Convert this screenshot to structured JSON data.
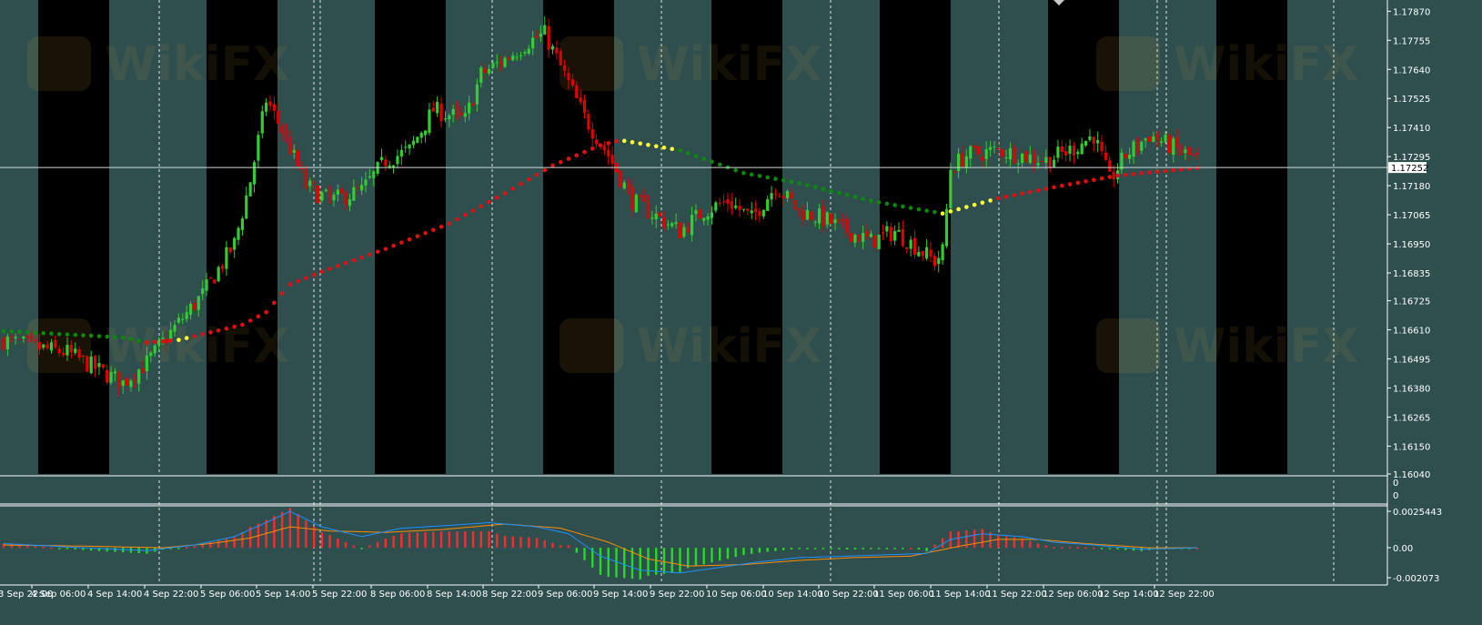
{
  "colors": {
    "background": "#2f4f4f",
    "session_band": "#000000",
    "bull_candle": "#32cd32",
    "bear_candle": "#e10000",
    "ma_up": "#e01010",
    "ma_flat": "#ffff33",
    "ma_down": "#0a8a0a",
    "macd_line": "#1e90ff",
    "signal_line": "#ff8c00",
    "hist_pos": "#ff2a2a",
    "hist_neg": "#22dd22",
    "grid_vline": "#ffffff",
    "axis_text": "#ffffff",
    "price_line": "#cfd8d8",
    "price_tag_bg": "#ffffff",
    "price_tag_fg": "#000000"
  },
  "watermark": {
    "text": "WikiFX"
  },
  "price_axis": {
    "labels": [
      "1.17870",
      "1.17755",
      "1.17640",
      "1.17525",
      "1.17410",
      "1.17295",
      "1.17180",
      "1.17065",
      "1.16950",
      "1.16835",
      "1.16725",
      "1.16610",
      "1.16495",
      "1.16380",
      "1.16265",
      "1.16150",
      "1.16040"
    ],
    "current_price": "1.17252"
  },
  "sub_window_1": {
    "labels": [
      "0",
      "0"
    ]
  },
  "sub_window_2": {
    "labels": [
      "0.0025443",
      "0.00",
      "-0.002073"
    ]
  },
  "time_axis": {
    "labels": [
      "3 Sep 22:00",
      "4 Sep 06:00",
      "4 Sep 14:00",
      "4 Sep 22:00",
      "5 Sep 06:00",
      "5 Sep 14:00",
      "5 Sep 22:00",
      "8 Sep 06:00",
      "8 Sep 14:00",
      "8 Sep 22:00",
      "9 Sep 06:00",
      "9 Sep 14:00",
      "9 Sep 22:00",
      "10 Sep 06:00",
      "10 Sep 14:00",
      "10 Sep 22:00",
      "11 Sep 06:00",
      "11 Sep 14:00",
      "11 Sep 22:00",
      "12 Sep 06:00",
      "12 Sep 14:00",
      "12 Sep 22:00"
    ]
  },
  "chart_data": [
    {
      "type": "candlestick",
      "title": "",
      "y_axis_ticks": [
        1.1787,
        1.17755,
        1.1764,
        1.17525,
        1.1741,
        1.17295,
        1.1718,
        1.17065,
        1.1695,
        1.16835,
        1.16725,
        1.1661,
        1.16495,
        1.1638,
        1.16265,
        1.1615,
        1.1604
      ],
      "ylim": [
        1.1604,
        1.179
      ],
      "x_labels": [
        "3 Sep 22:00",
        "4 Sep 06:00",
        "4 Sep 14:00",
        "4 Sep 22:00",
        "5 Sep 06:00",
        "5 Sep 14:00",
        "5 Sep 22:00",
        "8 Sep 06:00",
        "8 Sep 14:00",
        "8 Sep 22:00",
        "9 Sep 06:00",
        "9 Sep 14:00",
        "9 Sep 22:00",
        "10 Sep 06:00",
        "10 Sep 14:00",
        "10 Sep 22:00",
        "11 Sep 06:00",
        "11 Sep 14:00",
        "11 Sep 22:00",
        "12 Sep 06:00",
        "12 Sep 14:00",
        "12 Sep 22:00"
      ],
      "current_price": 1.17252,
      "close_path": [
        [
          0,
          1.1657
        ],
        [
          8,
          1.1654
        ],
        [
          16,
          1.1652
        ],
        [
          24,
          1.1645
        ],
        [
          30,
          1.164
        ],
        [
          36,
          1.1648
        ],
        [
          42,
          1.166
        ],
        [
          50,
          1.1675
        ],
        [
          58,
          1.1695
        ],
        [
          62,
          1.172
        ],
        [
          66,
          1.1752
        ],
        [
          70,
          1.174
        ],
        [
          76,
          1.1718
        ],
        [
          82,
          1.1712
        ],
        [
          90,
          1.1716
        ],
        [
          96,
          1.1728
        ],
        [
          102,
          1.1732
        ],
        [
          108,
          1.1748
        ],
        [
          116,
          1.1744
        ],
        [
          120,
          1.1762
        ],
        [
          126,
          1.1768
        ],
        [
          132,
          1.1775
        ],
        [
          136,
          1.1778
        ],
        [
          140,
          1.1765
        ],
        [
          146,
          1.1745
        ],
        [
          152,
          1.173
        ],
        [
          158,
          1.1712
        ],
        [
          164,
          1.1706
        ],
        [
          170,
          1.17
        ],
        [
          176,
          1.1708
        ],
        [
          182,
          1.1712
        ],
        [
          188,
          1.1705
        ],
        [
          194,
          1.1718
        ],
        [
          200,
          1.1708
        ],
        [
          206,
          1.1705
        ],
        [
          212,
          1.17
        ],
        [
          218,
          1.1696
        ],
        [
          224,
          1.17
        ],
        [
          230,
          1.1693
        ],
        [
          234,
          1.1688
        ],
        [
          236,
          1.1692
        ],
        [
          238,
          1.1725
        ],
        [
          242,
          1.173
        ],
        [
          250,
          1.1732
        ],
        [
          256,
          1.173
        ],
        [
          262,
          1.1728
        ],
        [
          268,
          1.1732
        ],
        [
          274,
          1.1738
        ],
        [
          278,
          1.172
        ],
        [
          282,
          1.173
        ],
        [
          288,
          1.1738
        ],
        [
          294,
          1.1733
        ],
        [
          300,
          1.1728
        ]
      ],
      "series": [
        {
          "name": "",
          "type": "candles",
          "count": 301,
          "seed": 7
        }
      ],
      "ma_dots": [
        {
          "x": 0,
          "y": 1.16605,
          "state": "down"
        },
        {
          "x": 30,
          "y": 1.1658,
          "state": "down"
        },
        {
          "x": 36,
          "y": 1.1656,
          "state": "up"
        },
        {
          "x": 44,
          "y": 1.1657,
          "state": "flat"
        },
        {
          "x": 48,
          "y": 1.16585,
          "state": "up"
        },
        {
          "x": 60,
          "y": 1.1663,
          "state": "up"
        },
        {
          "x": 66,
          "y": 1.1668,
          "state": "up"
        },
        {
          "x": 72,
          "y": 1.1679,
          "state": "up"
        },
        {
          "x": 80,
          "y": 1.1684,
          "state": "up"
        },
        {
          "x": 96,
          "y": 1.1693,
          "state": "up"
        },
        {
          "x": 112,
          "y": 1.1703,
          "state": "up"
        },
        {
          "x": 126,
          "y": 1.1715,
          "state": "up"
        },
        {
          "x": 138,
          "y": 1.1726,
          "state": "up"
        },
        {
          "x": 150,
          "y": 1.1734,
          "state": "up"
        },
        {
          "x": 155,
          "y": 1.1736,
          "state": "flat"
        },
        {
          "x": 170,
          "y": 1.1732,
          "state": "down"
        },
        {
          "x": 186,
          "y": 1.1723,
          "state": "down"
        },
        {
          "x": 200,
          "y": 1.1719,
          "state": "down"
        },
        {
          "x": 218,
          "y": 1.1712,
          "state": "down"
        },
        {
          "x": 236,
          "y": 1.1707,
          "state": "flat"
        },
        {
          "x": 250,
          "y": 1.1713,
          "state": "up"
        },
        {
          "x": 266,
          "y": 1.1718,
          "state": "up"
        },
        {
          "x": 280,
          "y": 1.1722,
          "state": "up"
        },
        {
          "x": 300,
          "y": 1.1725,
          "state": "up"
        }
      ]
    },
    {
      "type": "line",
      "title": "",
      "y_axis_ticks": [
        0.0025443,
        0.0,
        -0.002073
      ],
      "series": [
        {
          "name": "",
          "kind": "macd",
          "color_key": "macd_line"
        },
        {
          "name": "",
          "kind": "signal",
          "color_key": "signal_line"
        },
        {
          "name": "",
          "kind": "histogram"
        }
      ],
      "macd_path": [
        [
          0,
          0.0003
        ],
        [
          20,
          0.0
        ],
        [
          36,
          -0.0002
        ],
        [
          48,
          0.0002
        ],
        [
          58,
          0.0008
        ],
        [
          66,
          0.0018
        ],
        [
          72,
          0.0026
        ],
        [
          80,
          0.0015
        ],
        [
          90,
          0.0008
        ],
        [
          100,
          0.0014
        ],
        [
          112,
          0.0016
        ],
        [
          122,
          0.0018
        ],
        [
          134,
          0.0015
        ],
        [
          142,
          0.001
        ],
        [
          150,
          -0.0006
        ],
        [
          160,
          -0.0016
        ],
        [
          170,
          -0.0018
        ],
        [
          180,
          -0.0014
        ],
        [
          190,
          -0.001
        ],
        [
          200,
          -0.0007
        ],
        [
          212,
          -0.0006
        ],
        [
          222,
          -0.0005
        ],
        [
          232,
          -0.0004
        ],
        [
          238,
          0.0006
        ],
        [
          246,
          0.001
        ],
        [
          256,
          0.0008
        ],
        [
          264,
          0.0004
        ],
        [
          274,
          0.0002
        ],
        [
          286,
          -0.0001
        ],
        [
          300,
          0.0
        ]
      ],
      "signal_path": [
        [
          0,
          0.0002
        ],
        [
          24,
          0.0001
        ],
        [
          40,
          0.0
        ],
        [
          52,
          0.0003
        ],
        [
          62,
          0.0007
        ],
        [
          72,
          0.0015
        ],
        [
          82,
          0.0012
        ],
        [
          96,
          0.0011
        ],
        [
          110,
          0.0013
        ],
        [
          126,
          0.0017
        ],
        [
          140,
          0.0014
        ],
        [
          152,
          0.0004
        ],
        [
          162,
          -0.0008
        ],
        [
          172,
          -0.0013
        ],
        [
          186,
          -0.0012
        ],
        [
          200,
          -0.0009
        ],
        [
          214,
          -0.0007
        ],
        [
          228,
          -0.0006
        ],
        [
          240,
          0.0001
        ],
        [
          250,
          0.0006
        ],
        [
          260,
          0.0006
        ],
        [
          272,
          0.0003
        ],
        [
          288,
          0.0
        ],
        [
          300,
          0.0
        ]
      ]
    }
  ]
}
